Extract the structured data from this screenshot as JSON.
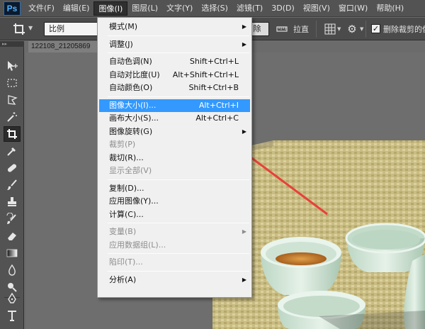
{
  "app": {
    "logo_text": "Ps"
  },
  "menubar": {
    "items": [
      "文件(F)",
      "编辑(E)",
      "图像(I)",
      "图层(L)",
      "文字(Y)",
      "选择(S)",
      "滤镜(T)",
      "3D(D)",
      "视图(V)",
      "窗口(W)",
      "帮助(H)"
    ],
    "active_index": 2
  },
  "options": {
    "ratio_value": "比例",
    "clear_label": "除",
    "straighten_label": "拉直",
    "delete_cropped_label": "删除裁剪的像",
    "delete_cropped_checked": "✓"
  },
  "document": {
    "tab_title": "122108_21205869"
  },
  "image_menu": {
    "items": [
      {
        "label": "模式(M)",
        "shortcut": "",
        "submenu": true,
        "disabled": false
      },
      {
        "separator": true
      },
      {
        "label": "调整(J)",
        "shortcut": "",
        "submenu": true,
        "disabled": false
      },
      {
        "separator": true
      },
      {
        "label": "自动色调(N)",
        "shortcut": "Shift+Ctrl+L",
        "submenu": false,
        "disabled": false
      },
      {
        "label": "自动对比度(U)",
        "shortcut": "Alt+Shift+Ctrl+L",
        "submenu": false,
        "disabled": false
      },
      {
        "label": "自动颜色(O)",
        "shortcut": "Shift+Ctrl+B",
        "submenu": false,
        "disabled": false
      },
      {
        "separator": true
      },
      {
        "label": "图像大小(I)...",
        "shortcut": "Alt+Ctrl+I",
        "submenu": false,
        "disabled": false,
        "highlighted": true
      },
      {
        "label": "画布大小(S)...",
        "shortcut": "Alt+Ctrl+C",
        "submenu": false,
        "disabled": false
      },
      {
        "label": "图像旋转(G)",
        "shortcut": "",
        "submenu": true,
        "disabled": false
      },
      {
        "label": "裁剪(P)",
        "shortcut": "",
        "submenu": false,
        "disabled": true
      },
      {
        "label": "裁切(R)...",
        "shortcut": "",
        "submenu": false,
        "disabled": false
      },
      {
        "label": "显示全部(V)",
        "shortcut": "",
        "submenu": false,
        "disabled": true
      },
      {
        "separator": true
      },
      {
        "label": "复制(D)...",
        "shortcut": "",
        "submenu": false,
        "disabled": false
      },
      {
        "label": "应用图像(Y)...",
        "shortcut": "",
        "submenu": false,
        "disabled": false
      },
      {
        "label": "计算(C)...",
        "shortcut": "",
        "submenu": false,
        "disabled": false
      },
      {
        "separator": true
      },
      {
        "label": "变量(B)",
        "shortcut": "",
        "submenu": true,
        "disabled": true
      },
      {
        "label": "应用数据组(L)...",
        "shortcut": "",
        "submenu": false,
        "disabled": true
      },
      {
        "separator": true
      },
      {
        "label": "陷印(T)...",
        "shortcut": "",
        "submenu": false,
        "disabled": true
      },
      {
        "separator": true
      },
      {
        "label": "分析(A)",
        "shortcut": "",
        "submenu": true,
        "disabled": false
      }
    ]
  },
  "icons": {
    "submenu_arrow": "▶",
    "dropdown_arrow": "▼",
    "gear": "⚙"
  },
  "colors": {
    "highlight": "#3399ff",
    "annotation_arrow": "#e8403a"
  }
}
